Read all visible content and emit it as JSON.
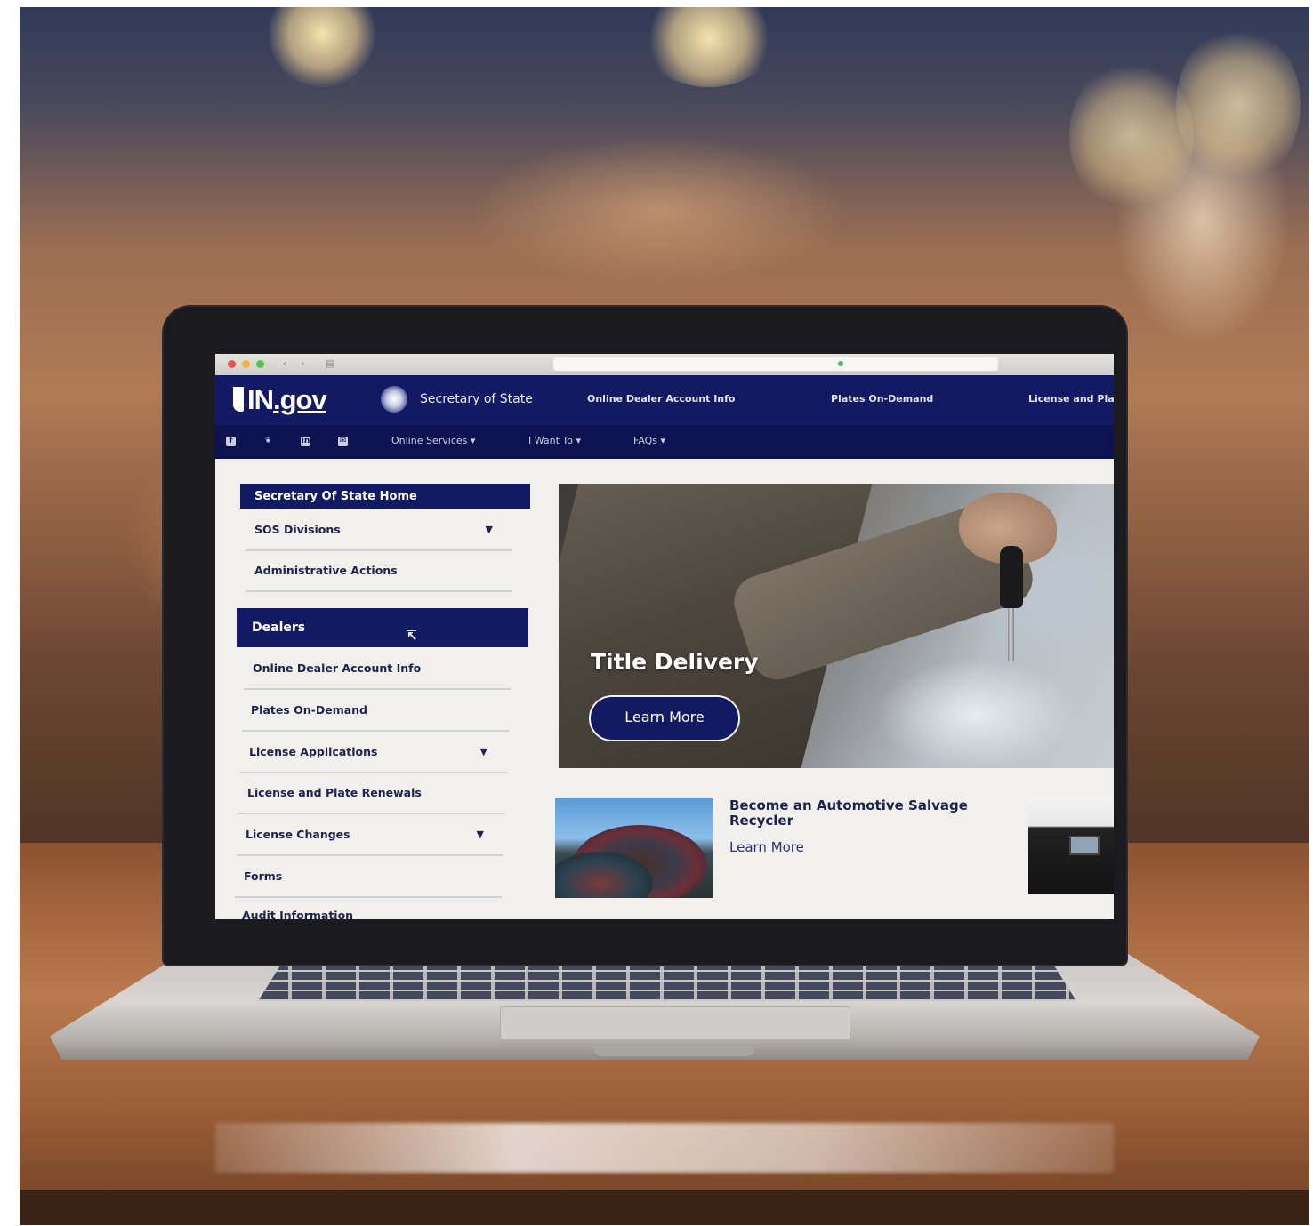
{
  "site": {
    "logo_text": "IN",
    "logo_suffix": ".gov",
    "agency_title": "Secretary of State",
    "header_links": [
      "Online Dealer Account Info",
      "Plates On-Demand",
      "License and Pla"
    ]
  },
  "subnav": {
    "social": [
      "facebook",
      "twitter",
      "linkedin",
      "email"
    ],
    "items": [
      "Online Services ▾",
      "I Want To ▾",
      "FAQs ▾"
    ]
  },
  "sidebar": {
    "home": "Secretary Of State Home",
    "items_top": [
      {
        "label": "SOS Divisions",
        "has_dropdown": true
      },
      {
        "label": "Administrative Actions",
        "has_dropdown": false
      }
    ],
    "active": "Dealers",
    "items": [
      {
        "label": "Online Dealer Account Info",
        "has_dropdown": false
      },
      {
        "label": "Plates On-Demand",
        "has_dropdown": false
      },
      {
        "label": "License Applications",
        "has_dropdown": true
      },
      {
        "label": "License and Plate Renewals",
        "has_dropdown": false
      },
      {
        "label": "License Changes",
        "has_dropdown": true
      },
      {
        "label": "Forms",
        "has_dropdown": false
      }
    ],
    "cutoff_item": "Audit Information"
  },
  "hero": {
    "title": "Title Delivery",
    "button": "Learn More"
  },
  "promo": {
    "title": "Become an Automotive Salvage Recycler",
    "link": "Learn More"
  },
  "colors": {
    "navy": "#121a63",
    "subnav": "#0d1350"
  }
}
